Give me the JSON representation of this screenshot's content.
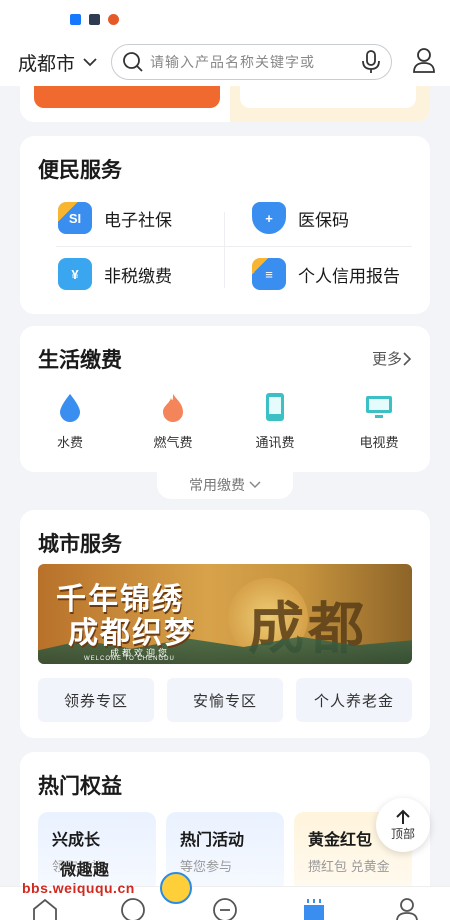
{
  "header": {
    "city": "成都市",
    "search_placeholder": "请输入产品名称关键字或"
  },
  "convenience": {
    "title": "便民服务",
    "items": [
      {
        "label": "电子社保",
        "icon": "social-security-icon",
        "badge": "SI",
        "color": "#3a8ef0"
      },
      {
        "label": "医保码",
        "icon": "medical-insurance-icon",
        "badge": "+",
        "color": "#3a8ef0"
      },
      {
        "label": "非税缴费",
        "icon": "tax-payment-icon",
        "badge": "¥",
        "color": "#3aa6f0"
      },
      {
        "label": "个人信用报告",
        "icon": "credit-report-icon",
        "badge": "≡",
        "color": "#3a8ef0"
      }
    ]
  },
  "life_pay": {
    "title": "生活缴费",
    "more": "更多",
    "items": [
      {
        "label": "水费",
        "icon": "water-drop-icon"
      },
      {
        "label": "燃气费",
        "icon": "flame-icon"
      },
      {
        "label": "通讯费",
        "icon": "phone-icon"
      },
      {
        "label": "电视费",
        "icon": "tv-icon"
      }
    ],
    "common_tab": "常用缴费"
  },
  "city": {
    "title": "城市服务",
    "banner": {
      "line1": "千年锦绣",
      "line2": "成都织梦",
      "line3": "成都欢迎您",
      "line4": "WELCOME TO CHENGDU",
      "art_text": "成都"
    },
    "zones": [
      "领券专区",
      "安愉专区",
      "个人养老金"
    ]
  },
  "benefits": {
    "title": "热门权益",
    "cards": [
      {
        "title": "兴成长",
        "sub": "领取好礼"
      },
      {
        "title": "热门活动",
        "sub": "等您参与"
      },
      {
        "title": "黄金红包",
        "sub": "攒红包 兑黄金"
      }
    ]
  },
  "top_button": "顶部",
  "watermark": {
    "line1": "微趣趣",
    "line2": "bbs.weiququ.cn"
  },
  "colors": {
    "accent": "#3a8ef0",
    "orange": "#f06a2f",
    "background": "#f3f4f8"
  }
}
